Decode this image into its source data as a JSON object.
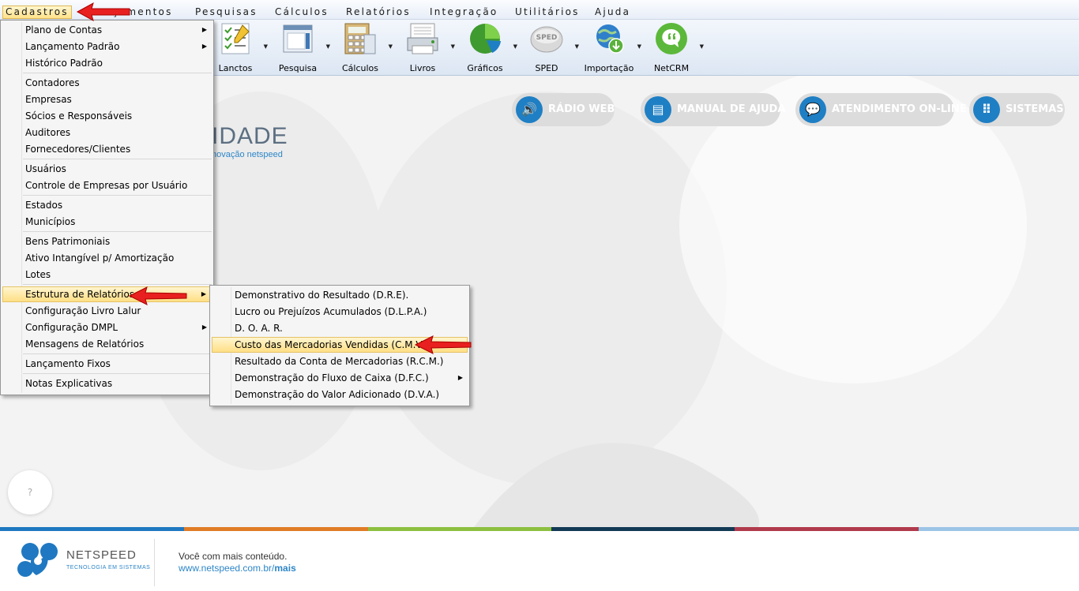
{
  "menubar": {
    "items": [
      "Cadastros",
      "Lançamentos",
      "Pesquisas",
      "Cálculos",
      "Relatórios",
      "Integração",
      "Utilitários",
      "Ajuda"
    ],
    "partial_label": "çamentos"
  },
  "toolbar": {
    "buttons": [
      {
        "label": "Lanctos",
        "icon": "checklist-icon"
      },
      {
        "label": "Pesquisa",
        "icon": "window-icon"
      },
      {
        "label": "Cálculos",
        "icon": "calculator-icon"
      },
      {
        "label": "Livros",
        "icon": "printer-icon"
      },
      {
        "label": "Gráficos",
        "icon": "pie-chart-icon"
      },
      {
        "label": "SPED",
        "icon": "sped-icon",
        "badge": "SPED"
      },
      {
        "label": "Importação",
        "icon": "globe-download-icon"
      },
      {
        "label": "NetCRM",
        "icon": "chat-bubble-icon"
      }
    ]
  },
  "top_buttons": {
    "radio": "RÁDIO WEB",
    "manual": "MANUAL DE AJUDA",
    "atendimento": "ATENDIMENTO ON-LINE",
    "sistemas": "SISTEMAS"
  },
  "logo": {
    "text": "IDADE",
    "sub": "novação netspeed"
  },
  "help_label": "?",
  "cadastros_menu": {
    "items": [
      "Plano de Contas",
      "Lançamento Padrão",
      "Histórico Padrão",
      "Contadores",
      "Empresas",
      "Sócios e Responsáveis",
      "Auditores",
      "Fornecedores/Clientes",
      "Usuários",
      "Controle de Empresas por Usuário",
      "Estados",
      "Municípios",
      "Bens Patrimoniais",
      "Ativo Intangível p/ Amortização",
      "Lotes",
      "Estrutura de Relatórios",
      "Configuração Livro Lalur",
      "Configuração DMPL",
      "Mensagens de Relatórios",
      "Lançamento Fixos",
      "Notas Explicativas"
    ]
  },
  "estrutura_submenu": {
    "items": [
      "Demonstrativo do Resultado (D.R.E).",
      "Lucro ou Prejuízos Acumulados (D.L.P.A.)",
      "D. O. A. R.",
      "Custo das Mercadorias Vendidas (C.M.V.)",
      "Resultado da Conta de Mercadorias (R.C.M.)",
      "Demonstração do Fluxo de Caixa (D.F.C.)",
      "Demonstração do Valor Adicionado (D.V.A.)"
    ]
  },
  "footer": {
    "brand": "NETSPEED",
    "tagline": "TECNOLOGIA EM SISTEMAS",
    "line1": "Você com mais conteúdo.",
    "url_prefix": "www.netspeed.com.br/",
    "url_suffix": "mais"
  },
  "colors": {
    "accent_blue": "#1f7fc4",
    "highlight": "#ffdf86",
    "stripe": [
      "#1f78c1",
      "#e07b26",
      "#8cbf3f",
      "#123a55",
      "#b03a4c",
      "#9cc4e6"
    ]
  }
}
